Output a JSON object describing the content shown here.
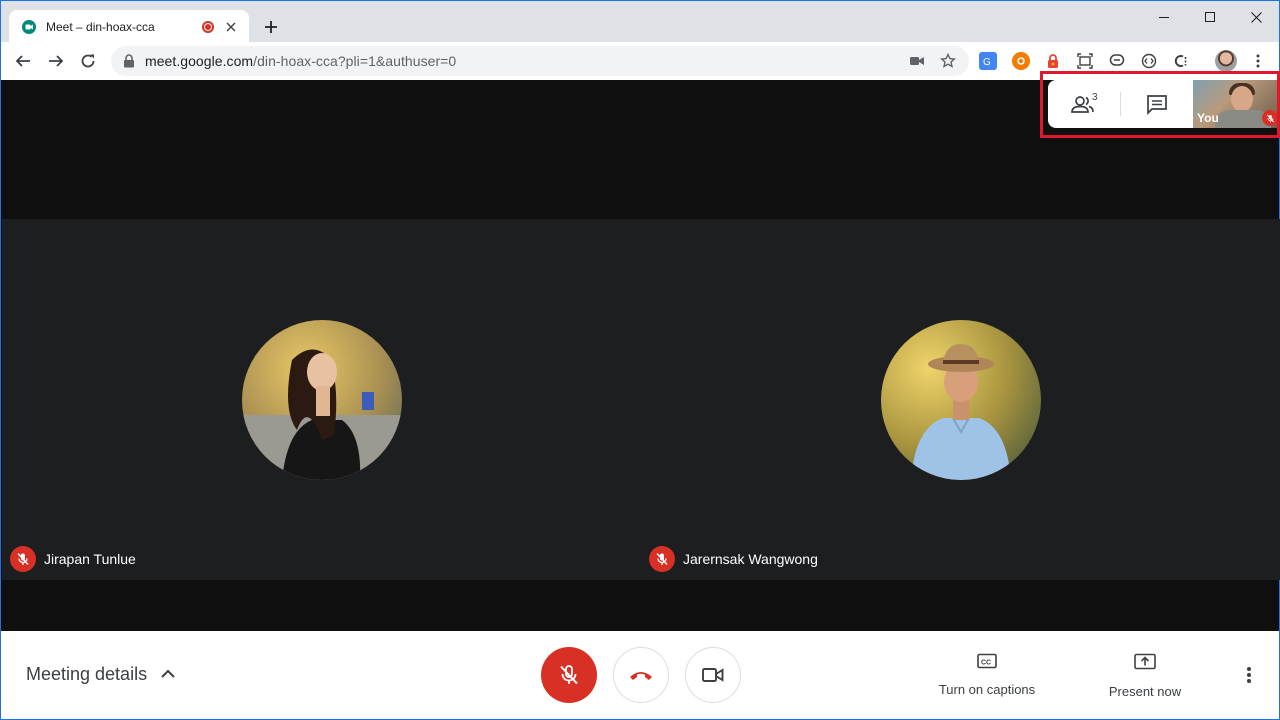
{
  "browser": {
    "tab_title": "Meet – din-hoax-cca",
    "url_host": "meet.google.com",
    "url_path": "/din-hoax-cca?pli=1&authuser=0"
  },
  "meet": {
    "participant_count": "3",
    "self_label": "You",
    "participants": [
      {
        "name": "Jirapan Tunlue"
      },
      {
        "name": "Jarernsak Wangwong"
      }
    ]
  },
  "bottom": {
    "meeting_details": "Meeting details",
    "captions_label": "Turn on captions",
    "present_label": "Present now"
  },
  "colors": {
    "accent": "#1a73e8",
    "danger": "#d93025",
    "highlight": "#e0182d"
  }
}
